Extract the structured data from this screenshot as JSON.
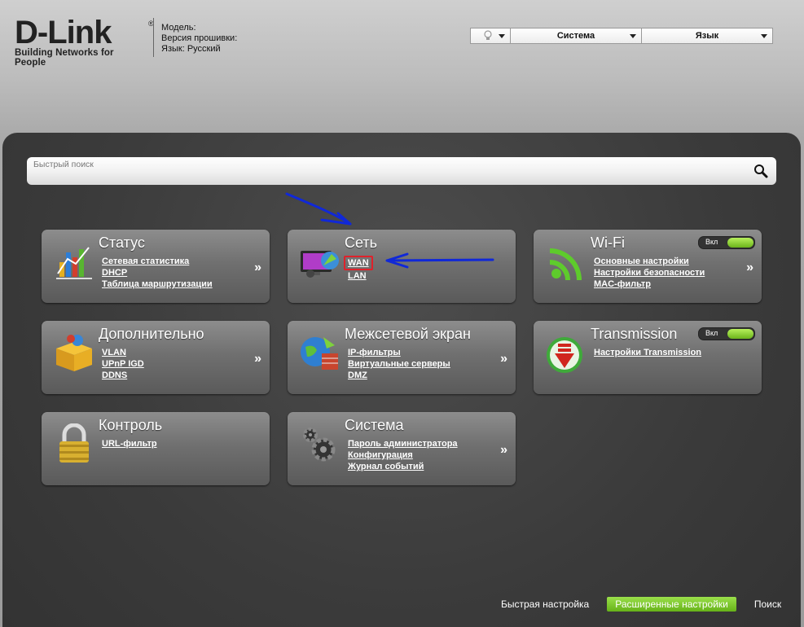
{
  "header": {
    "logo_text": "D-Link",
    "logo_reg": "®",
    "logo_tagline": "Building Networks for People",
    "device_info": {
      "model_label": "Модель:",
      "firmware_label": "Версия прошивки:",
      "language_label": "Язык: Русский"
    },
    "topbar": {
      "system_label": "Система",
      "language_label": "Язык"
    }
  },
  "search": {
    "placeholder": "Быстрый поиск"
  },
  "tiles": {
    "status": {
      "title": "Статус",
      "links": [
        "Сетевая статистика",
        "DHCP",
        "Таблица маршрутизации"
      ],
      "more": "»"
    },
    "network": {
      "title": "Сеть",
      "links": [
        "WAN",
        "LAN"
      ],
      "more": ""
    },
    "wifi": {
      "title": "Wi-Fi",
      "toggle_label": "Вкл",
      "links": [
        "Основные настройки",
        "Настройки безопасности",
        "MAC-фильтр"
      ],
      "more": "»"
    },
    "advanced": {
      "title": "Дополнительно",
      "links": [
        "VLAN",
        "UPnP IGD",
        "DDNS"
      ],
      "more": "»"
    },
    "firewall": {
      "title": "Межсетевой экран",
      "links": [
        "IP-фильтры",
        "Виртуальные серверы",
        "DMZ"
      ],
      "more": "»"
    },
    "transmission": {
      "title": "Transmission",
      "toggle_label": "Вкл",
      "links": [
        "Настройки Transmission"
      ],
      "more": ""
    },
    "control": {
      "title": "Контроль",
      "links": [
        "URL-фильтр"
      ],
      "more": ""
    },
    "system": {
      "title": "Система",
      "links": [
        "Пароль администратора",
        "Конфигурация",
        "Журнал событий"
      ],
      "more": "»"
    }
  },
  "footer": {
    "quick_setup": "Быстрая настройка",
    "advanced_setup": "Расширенные настройки",
    "search": "Поиск"
  },
  "colors": {
    "accent_green": "#7cc630",
    "annotation_blue": "#1028d8",
    "annotation_red": "#e0212a"
  }
}
